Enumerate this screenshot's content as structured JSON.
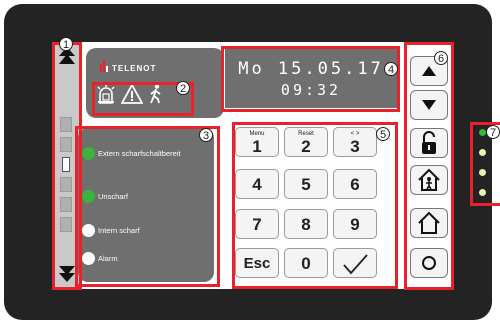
{
  "brand": {
    "name": "TELENOT"
  },
  "datetime": {
    "date": "Mo 15.05.17",
    "time": "09:32"
  },
  "callouts": [
    "1",
    "2",
    "3",
    "4",
    "5",
    "6",
    "7"
  ],
  "status_items": [
    {
      "label": "Extern scharfschaltbereit",
      "color": "#3cb33c"
    },
    {
      "label": "Unscharf",
      "color": "#3cb33c"
    },
    {
      "label": "Intern scharf",
      "color": "#ffffff"
    },
    {
      "label": "Alarm",
      "color": "#ffffff"
    }
  ],
  "keys": [
    {
      "sub": "Menu",
      "label": "1"
    },
    {
      "sub": "Reset",
      "label": "2"
    },
    {
      "sub": "< >",
      "label": "3"
    },
    {
      "sub": "",
      "label": "4"
    },
    {
      "sub": "",
      "label": "5"
    },
    {
      "sub": "",
      "label": "6"
    },
    {
      "sub": "",
      "label": "7"
    },
    {
      "sub": "",
      "label": "8"
    },
    {
      "sub": "",
      "label": "9"
    },
    {
      "sub": "",
      "label": "Esc"
    },
    {
      "sub": "",
      "label": "0"
    },
    {
      "sub": "",
      "label": "✓",
      "icon": "checkmark-icon"
    }
  ],
  "right_buttons": [
    "arrow-up-icon",
    "arrow-down-icon",
    "unlock-icon",
    "house-person-icon",
    "house-icon",
    "circle-icon"
  ],
  "leds": [
    "#3cb33c",
    "#e8f0b0",
    "#e8f0b0",
    "#e8f0b0"
  ],
  "accent": "#e8212a"
}
